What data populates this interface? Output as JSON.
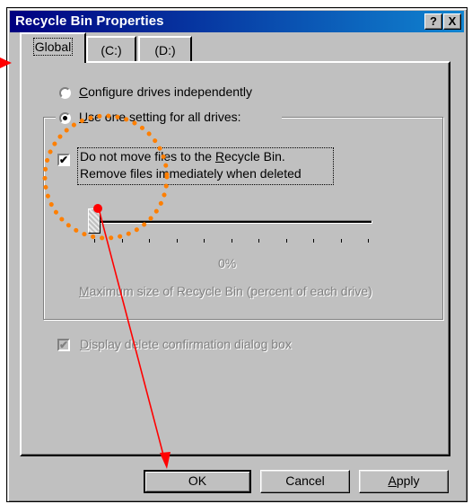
{
  "window": {
    "title": "Recycle Bin Properties",
    "help_label": "?",
    "close_label": "X"
  },
  "tabs": [
    {
      "label": "Global",
      "active": true
    },
    {
      "label": "(C:)",
      "active": false
    },
    {
      "label": "(D:)",
      "active": false
    }
  ],
  "global": {
    "radio_independent": {
      "prefix": "",
      "accel": "C",
      "rest": "onfigure drives independently",
      "selected": false
    },
    "radio_one_setting": {
      "prefix": "",
      "accel": "U",
      "rest": "se one setting for all drives:",
      "selected": true
    },
    "do_not_move": {
      "checked": true,
      "line1_prefix": "Do not move files to the ",
      "line1_accel": "R",
      "line1_rest": "ecycle Bin.",
      "line2": "Remove files immediately when deleted"
    },
    "slider": {
      "value_label": "0%",
      "value_percent": 0,
      "tick_count": 11
    },
    "slider_caption": {
      "accel": "M",
      "rest": "aximum size of Recycle Bin (percent of each drive)"
    },
    "display_confirmation": {
      "checked": true,
      "accel": "D",
      "rest": "isplay delete confirmation dialog box",
      "enabled": false
    }
  },
  "buttons": {
    "ok": "OK",
    "cancel": "Cancel",
    "apply_accel": "A",
    "apply_rest": "pply"
  },
  "annotation": {
    "color": "#ff0000",
    "circle_color": "#ff7f00"
  }
}
